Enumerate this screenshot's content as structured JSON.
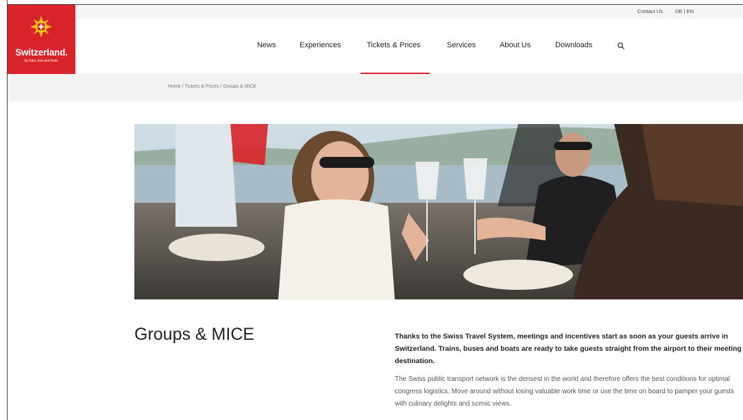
{
  "logo": {
    "brand": "Switzerland.",
    "tagline": "by train, bus and boat."
  },
  "utility": {
    "contact": "Contact Us",
    "lang_de": "DE",
    "separator": "|",
    "lang_en": "EN"
  },
  "nav": {
    "items": [
      {
        "label": "News"
      },
      {
        "label": "Experiences"
      },
      {
        "label": "Tickets & Prices",
        "active": true
      },
      {
        "label": "Services"
      },
      {
        "label": "About Us"
      },
      {
        "label": "Downloads"
      }
    ],
    "search_icon": "search-icon"
  },
  "breadcrumb": {
    "home": "Home",
    "sep": "/",
    "parent": "Tickets & Prices",
    "current": "Groups & MICE"
  },
  "hero": {
    "icon": "photo-people-toasting-on-boat"
  },
  "content": {
    "title": "Groups & MICE",
    "intro": "Thanks to the Swiss Travel System, meetings and incentives start as soon as your guests arrive in Switzerland. Trains, buses and boats are ready to take guests straight from the airport to their meeting destination.",
    "body": "The Swiss public transport network is the densest in the world and therefore offers the best conditions for optimal congress logistics. Move around without losing valuable work time or use the time on board to pamper your guests with culinary delights and scenic views."
  },
  "colors": {
    "brand_red": "#d8232a",
    "breadcrumb_bg": "#f2f2f2"
  }
}
